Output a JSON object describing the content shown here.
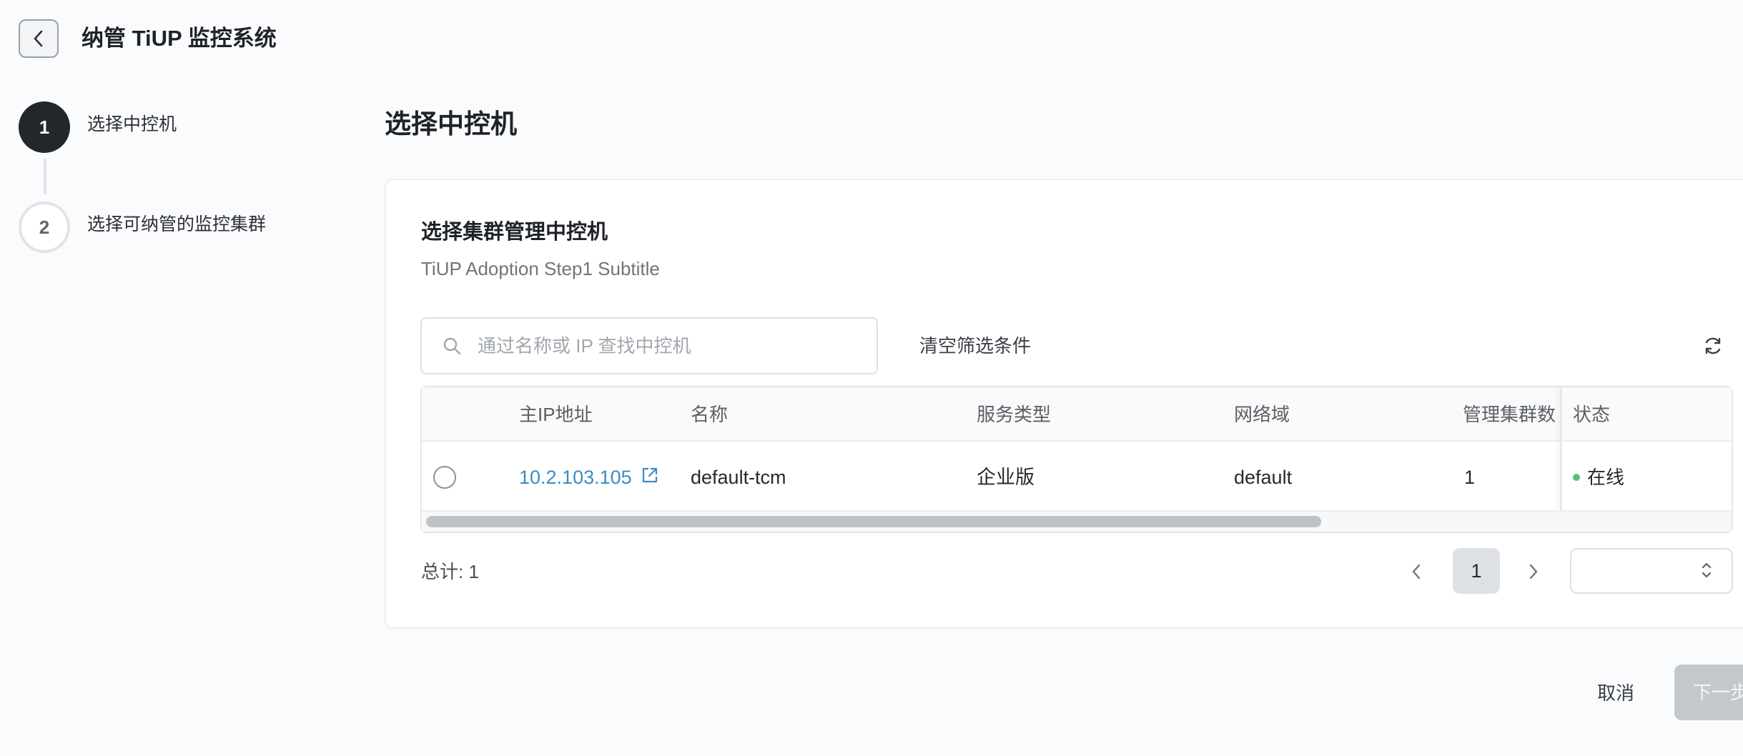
{
  "header": {
    "title": "纳管 TiUP 监控系统",
    "back_icon": "chevron-left-icon"
  },
  "steps": [
    {
      "number": "1",
      "label": "选择中控机",
      "state": "active"
    },
    {
      "number": "2",
      "label": "选择可纳管的监控集群",
      "state": "pending"
    }
  ],
  "main": {
    "title": "选择中控机"
  },
  "card": {
    "title": "选择集群管理中控机",
    "subtitle": "TiUP Adoption Step1 Subtitle",
    "search": {
      "placeholder": "通过名称或 IP 查找中控机",
      "value": ""
    },
    "clear_filter_label": "清空筛选条件",
    "refresh_icon": "refresh-icon"
  },
  "table": {
    "columns": [
      "主IP地址",
      "名称",
      "服务类型",
      "网络域",
      "管理集群数",
      "状态"
    ],
    "rows": [
      {
        "ip": "10.2.103.105",
        "name": "default-tcm",
        "service_type": "企业版",
        "network_domain": "default",
        "cluster_count": "1",
        "status": "在线",
        "status_color": "#52c27a"
      }
    ]
  },
  "pagination": {
    "total_label": "总计: 1",
    "current_page": "1",
    "page_size_value": ""
  },
  "footer": {
    "cancel_label": "取消",
    "next_label": "下一步"
  },
  "colors": {
    "link": "#3d8bc2",
    "online": "#52c27a",
    "step_active": "#23272b",
    "next_disabled": "#c3c8cd"
  }
}
